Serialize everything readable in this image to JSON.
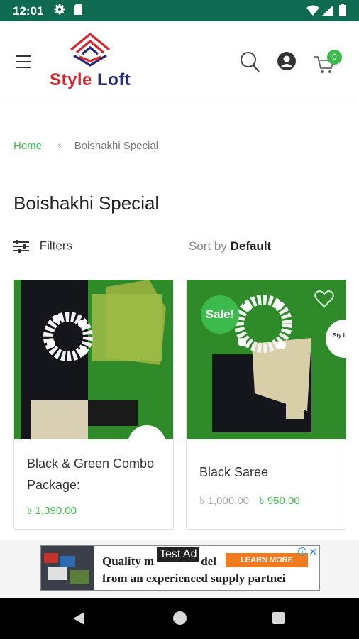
{
  "status_bar": {
    "time": "12:01"
  },
  "header": {
    "logo_word1": "Style",
    "logo_word2": "Loft",
    "cart_count": "0"
  },
  "breadcrumb": {
    "home": "Home",
    "separator": "›",
    "current": "Boishakhi Special"
  },
  "page": {
    "title": "Boishakhi Special",
    "filters_label": "Filters",
    "sort_prefix": "Sort by",
    "sort_value": "Default"
  },
  "products": [
    {
      "name": "Black & Green Combo Package:",
      "price": "৳ 1,390.00"
    },
    {
      "name": "Black Saree",
      "old_price": "৳ 1,000.00",
      "price": "৳ 950.00",
      "badge": "Sale!"
    }
  ],
  "quick_logo_text": "Sty Lo",
  "ad": {
    "label": "Test Ad",
    "line1": "Quality m",
    "line1_end": "del",
    "line2": "from an experienced supply partnei",
    "cta": "LEARN MORE"
  },
  "colors": {
    "status_bar": "#0f6a52",
    "accent_green": "#3dba4e",
    "logo_red": "#d8262f",
    "logo_navy": "#24297a",
    "ad_cta": "#f47a20"
  },
  "icons": [
    "gear-icon",
    "sd-card-icon",
    "wifi-icon",
    "signal-icon",
    "battery-icon",
    "menu-icon",
    "search-icon",
    "account-icon",
    "cart-icon",
    "filters-icon",
    "heart-icon",
    "back-icon",
    "home-icon",
    "recents-icon",
    "info-icon",
    "close-icon"
  ]
}
